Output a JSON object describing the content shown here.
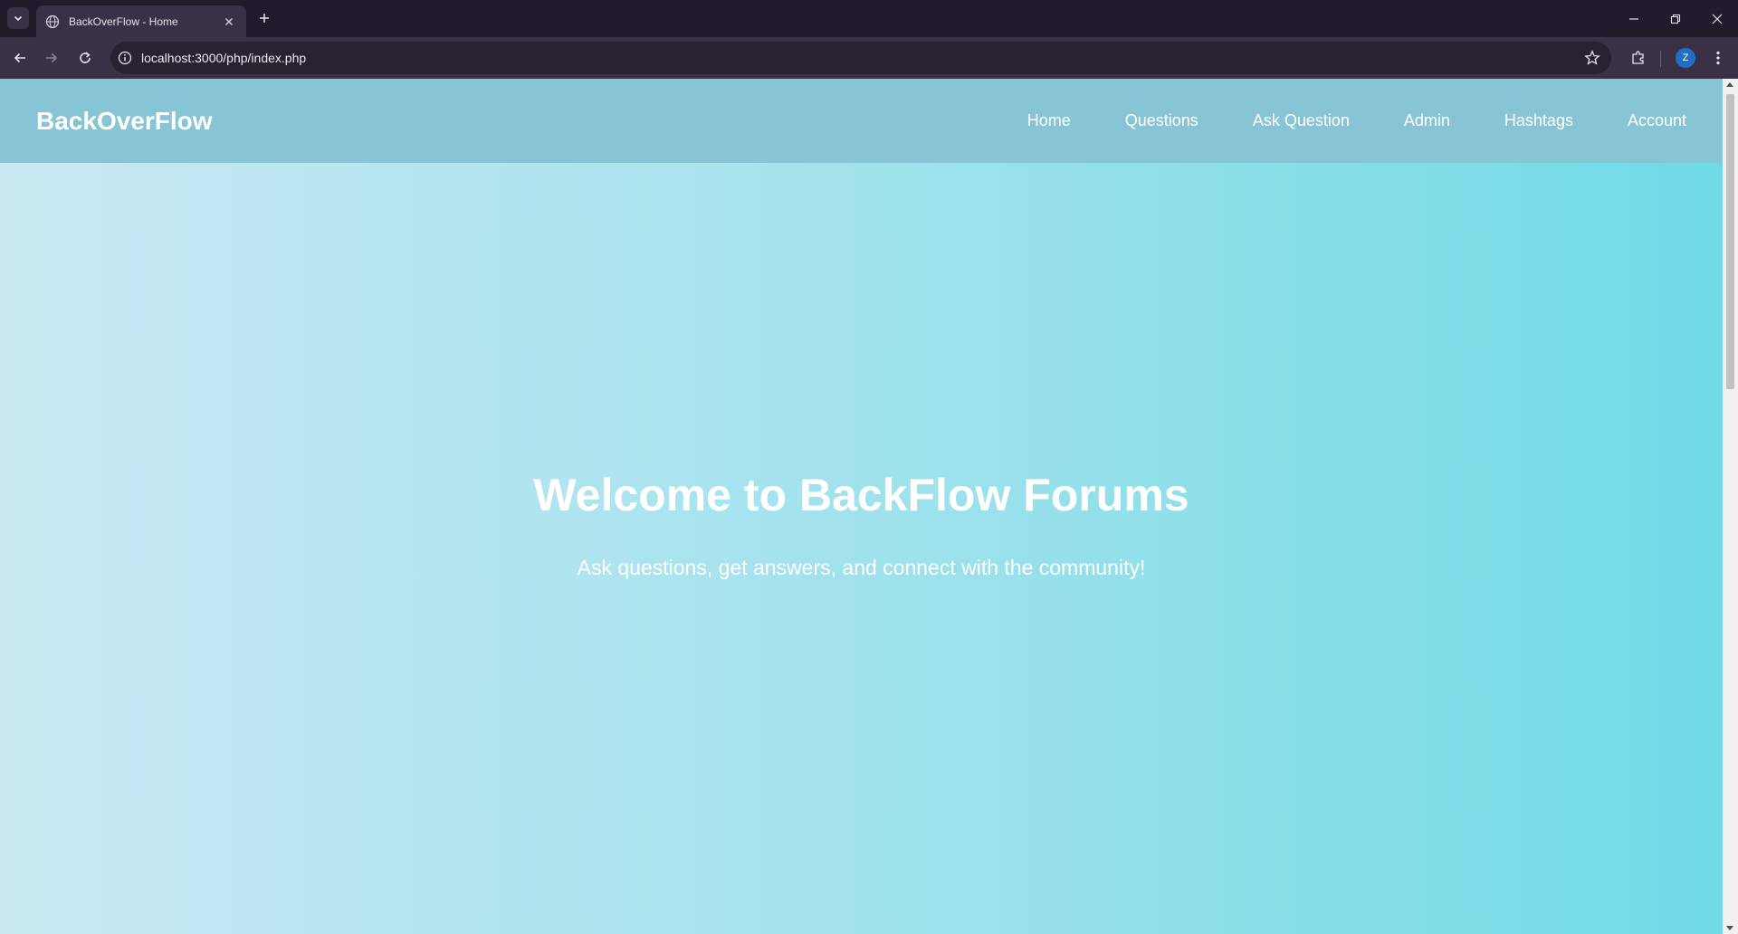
{
  "browser": {
    "tab_title": "BackOverFlow - Home",
    "url": "localhost:3000/php/index.php",
    "profile_initial": "Z",
    "icons": {
      "tab_search": "chevron-down-icon",
      "favicon": "globe-icon",
      "tab_close": "close-icon",
      "new_tab": "plus-icon",
      "back": "arrow-left-icon",
      "forward": "arrow-right-icon",
      "reload": "reload-icon",
      "site_info": "info-icon",
      "bookmark": "star-icon",
      "extensions": "puzzle-icon",
      "menu": "kebab-menu-icon",
      "minimize": "minimize-icon",
      "restore": "restore-icon",
      "close_window": "close-icon"
    }
  },
  "site": {
    "brand": "BackOverFlow",
    "nav": [
      {
        "label": "Home"
      },
      {
        "label": "Questions"
      },
      {
        "label": "Ask Question"
      },
      {
        "label": "Admin"
      },
      {
        "label": "Hashtags"
      },
      {
        "label": "Account"
      }
    ]
  },
  "hero": {
    "title": "Welcome to BackFlow Forums",
    "subtitle": "Ask questions, get answers, and connect with the community!"
  },
  "colors": {
    "header_bg": "#87c4d5",
    "gradient_start": "#c9e8f2",
    "gradient_end": "#6fdae6",
    "text": "#ffffff",
    "chrome_bg": "#231a2c",
    "toolbar_bg": "#3b3146"
  }
}
